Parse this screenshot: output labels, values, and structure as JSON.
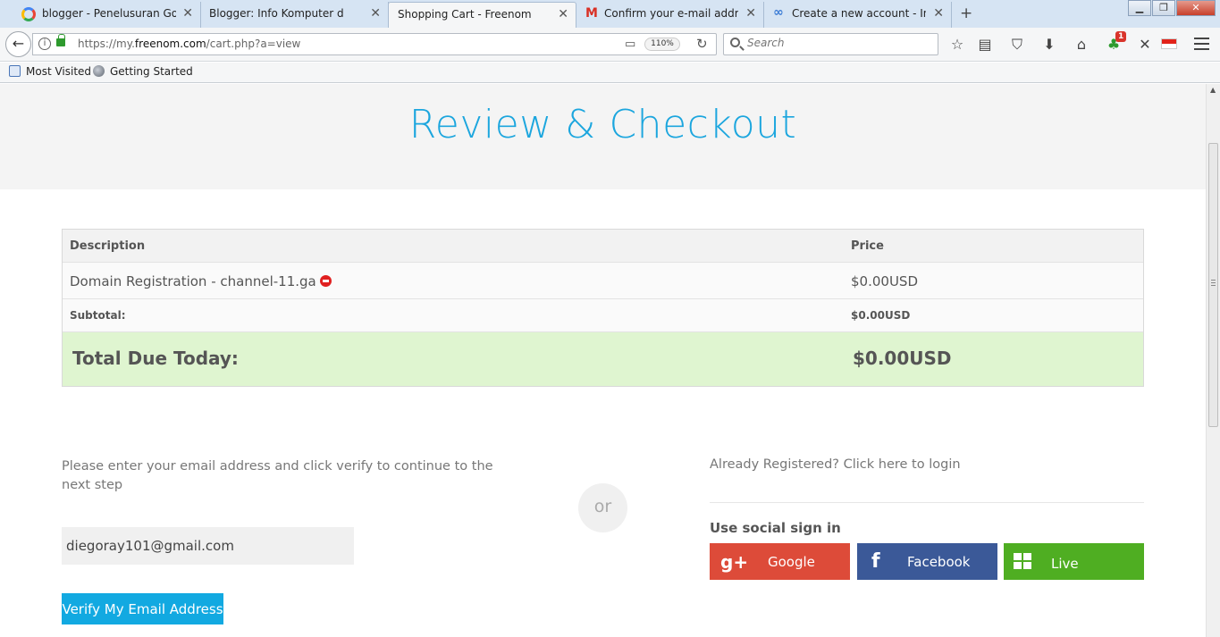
{
  "browser": {
    "tabs": [
      {
        "title": "blogger - Penelusuran Google"
      },
      {
        "title": "Blogger: Info Komputer dan Teknologi"
      },
      {
        "title": "Shopping Cart - Freenom"
      },
      {
        "title": "Confirm your e-mail address"
      },
      {
        "title": "Create a new account - Infinity"
      }
    ],
    "new_tab": "+",
    "url_prefix": "https://my.",
    "url_domain": "freenom.com",
    "url_path": "/cart.php?a=view",
    "zoom": "110%",
    "search_placeholder": "Search",
    "notification_count": "1",
    "bookmarks": [
      {
        "label": "Most Visited"
      },
      {
        "label": "Getting Started"
      }
    ]
  },
  "page": {
    "title": "Review & Checkout",
    "table": {
      "headers": [
        "Description",
        "Price"
      ],
      "item": {
        "description": "Domain Registration - channel-11.ga",
        "price": "$0.00USD"
      },
      "subtotal": {
        "label": "Subtotal:",
        "value": "$0.00USD"
      },
      "total": {
        "label": "Total Due Today:",
        "value": "$0.00USD"
      }
    },
    "email_section": {
      "instruction": "Please enter your email address and click verify to continue to the next step",
      "email_value": "diegoray101@gmail.com",
      "verify_label": "Verify My Email Address"
    },
    "or_label": "or",
    "login_prompt": "Already Registered? Click here to login",
    "social": {
      "heading": "Use social sign in",
      "google": "Google",
      "facebook": "Facebook",
      "live": "Live"
    },
    "colors": {
      "accent": "#1ca6de",
      "verify_button": "#12a9e1",
      "total_row": "#dff5d0",
      "google": "#dd4b39",
      "facebook": "#3b5998",
      "live": "#4fae22"
    }
  }
}
